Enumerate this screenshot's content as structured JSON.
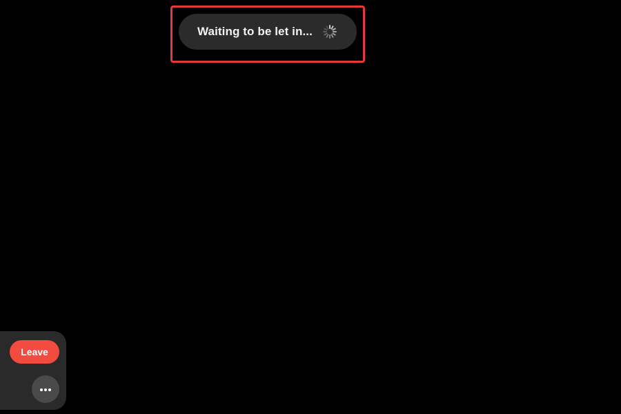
{
  "status": {
    "text": "Waiting to be let in...",
    "icon": "loading-spinner-icon"
  },
  "controls": {
    "leave_label": "Leave",
    "more_icon": "more-options-icon"
  },
  "colors": {
    "background": "#000000",
    "highlight": "#e5383b",
    "pill": "#2b2b2b",
    "leave": "#f24b3f",
    "panel": "#2a2a2a",
    "more_button": "#4a4a4a"
  }
}
